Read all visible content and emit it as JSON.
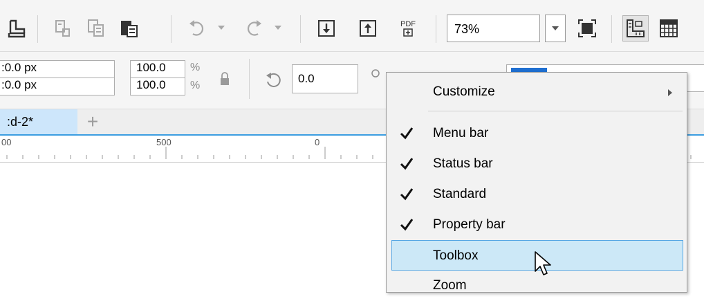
{
  "standard_toolbar": {
    "zoom_level": "73%",
    "pdf_label": "PDF"
  },
  "property_bar": {
    "x_value": ":0.0 px",
    "y_value": ":0.0 px",
    "width_scale": "100.0",
    "height_scale": "100.0",
    "scale_unit": "%",
    "rotation_value": "0.0"
  },
  "document_tabs": {
    "active_tab": ":d-2*",
    "add_tab_label": "+"
  },
  "ruler": {
    "labels": [
      "00",
      "500",
      "0"
    ]
  },
  "context_menu": {
    "items": [
      {
        "label": "Customize",
        "checked": false,
        "submenu": true
      },
      {
        "label": "Menu bar",
        "checked": true
      },
      {
        "label": "Status bar",
        "checked": true
      },
      {
        "label": "Standard",
        "checked": true
      },
      {
        "label": "Property bar",
        "checked": true
      },
      {
        "label": "Toolbox",
        "checked": false,
        "highlighted": true
      },
      {
        "label": "Zoom",
        "checked": false
      }
    ]
  },
  "colors": {
    "accent_blue": "#3b9de1",
    "menu_highlight": "#cce8f7",
    "menu_highlight_border": "#56a7e4",
    "tab_active": "#cde6fb",
    "swatch_blue": "#1f6fd1"
  }
}
